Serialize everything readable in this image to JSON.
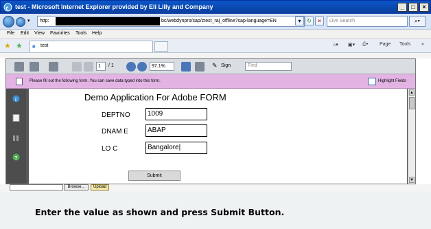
{
  "window": {
    "title": "test - Microsoft Internet Explorer provided by Eli Lilly and Company",
    "minimize": "_",
    "maximize": "□",
    "close": "×"
  },
  "address": {
    "prefix": "http:",
    "url_suffix": "bc/webdynpro/sap/ztest_raj_offline?sap-language=EN",
    "search_placeholder": "Live Search"
  },
  "menu": [
    "File",
    "Edit",
    "View",
    "Favorites",
    "Tools",
    "Help"
  ],
  "tab": {
    "title": "test"
  },
  "right_tools": {
    "page": "Page",
    "tools": "Tools"
  },
  "pdf_toolbar": {
    "page_current": "1",
    "page_total": "/ 1",
    "zoom": "97.1%",
    "sign": "Sign",
    "find_placeholder": "Find"
  },
  "message_bar": {
    "text": "Please fill out the following form. You can save data typed into this form.",
    "highlight_label": "Highlight Fields"
  },
  "form": {
    "title": "Demo Application For Adobe FORM",
    "fields": [
      {
        "label": "DEPTNO",
        "value": "1009"
      },
      {
        "label": "DNAM E",
        "value": "ABAP"
      },
      {
        "label": "LO C",
        "value": "Bangalore|"
      }
    ],
    "submit_label": "Submit"
  },
  "upload": {
    "browse_label": "Browse...",
    "upload_label": "Upload"
  },
  "instruction": "Enter the value as shown and press Submit Button."
}
